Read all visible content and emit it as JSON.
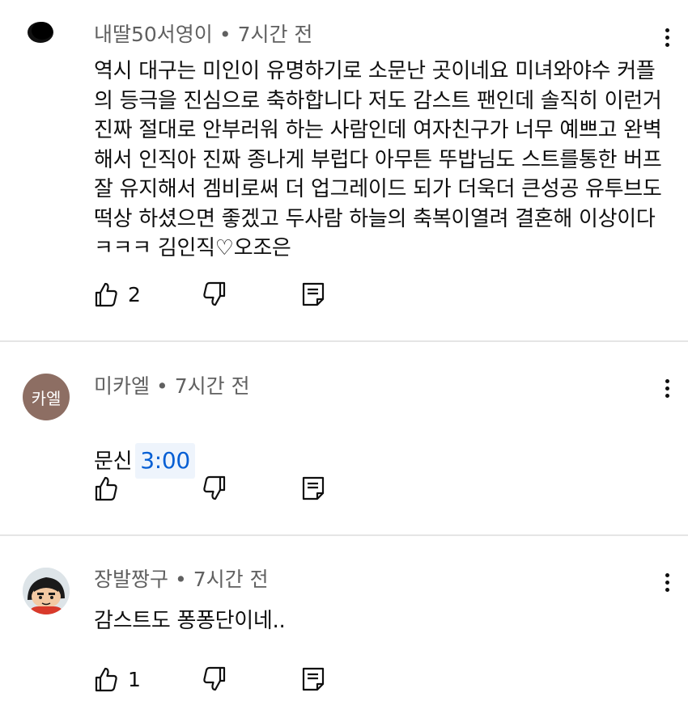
{
  "comments": [
    {
      "author": "내딸50서영이",
      "time": "7시간 전",
      "avatar_color": "#111111",
      "text": "역시 대구는 미인이 유명하기로 소문난 곳이네요 미녀와야수 커플\n의 등극을 진심으로 축하합니다 저도 감스트 팬인데 솔직히 이런거\n진짜 절대로 안부러워 하는 사람인데 여자친구가 너무 예쁘고 완벽\n해서 인직아 진짜 종나게 부럽다 아무튼 뚜밥님도 스트를통한 버프\n잘 유지해서 겜비로써 더 업그레이드 되가 더욱더 큰성공 유투브도\n떡상 하셨으면 좋겠고 두사람 하늘의 축복이열려 결혼해 이상이다\nㅋㅋㅋ 김인직♡오조은",
      "likes": "2"
    },
    {
      "author": "미카엘",
      "time": "7시간 전",
      "avatar_text": "카엘",
      "avatar_color": "#8d6e63",
      "text": "문신",
      "timestamp_link": "3:00",
      "likes": ""
    },
    {
      "author": "장발짱구",
      "time": "7시간 전",
      "text": "감스트도 퐁퐁단이네..",
      "likes": "1"
    }
  ],
  "meta_separator": "•",
  "colors": {
    "meta_gray": "#606060",
    "link_blue": "#065fd4",
    "divider": "#e5e5e5"
  },
  "icons": [
    "like-icon",
    "dislike-icon",
    "reply-icon",
    "more-vert-icon"
  ]
}
